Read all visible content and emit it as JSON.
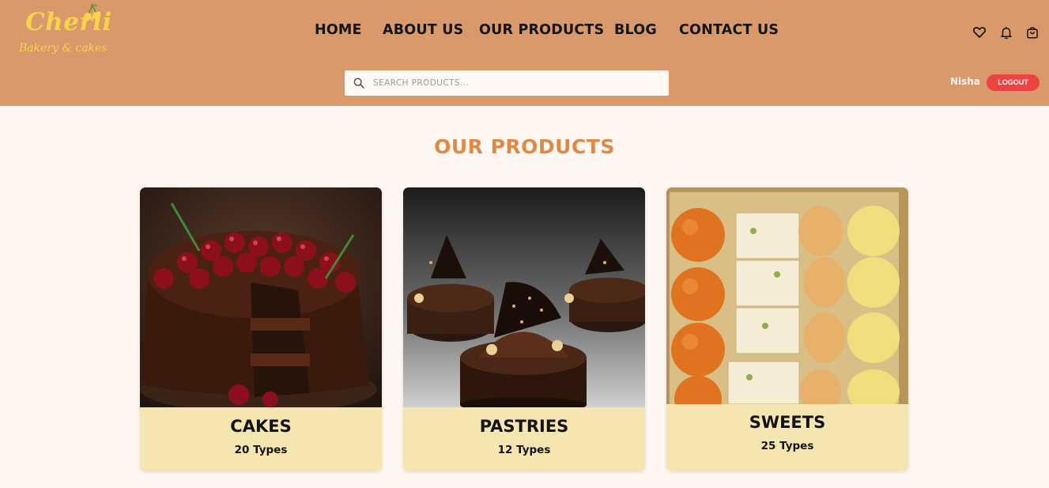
{
  "brand": {
    "title": "Cherii",
    "subtitle": "Bakery & cakes"
  },
  "nav": {
    "home": "HOME",
    "about": "ABOUT US",
    "products": "OUR PRODUCTS",
    "blog": "BLOG",
    "contact": "CONTACT US"
  },
  "icons": {
    "wishlist": "heart-icon",
    "notifications": "bell-icon",
    "cart": "shopping-bag-icon"
  },
  "search": {
    "placeholder": "SEARCH PRODUCTS...",
    "value": ""
  },
  "user": {
    "name": "Nisha",
    "logout_label": "LOGOUT"
  },
  "section": {
    "title": "OUR PRODUCTS"
  },
  "products": [
    {
      "name": "CAKES",
      "types": "20 Types"
    },
    {
      "name": "PASTRIES",
      "types": "12 Types"
    },
    {
      "name": "SWEETS",
      "types": "25 Types"
    }
  ],
  "colors": {
    "header_bg": "#d9996a",
    "page_bg": "#fef6f1",
    "accent": "#dd8a47",
    "card_footer": "#f5e5b0",
    "logout": "#ee4343",
    "logo": "#f6d34b"
  }
}
